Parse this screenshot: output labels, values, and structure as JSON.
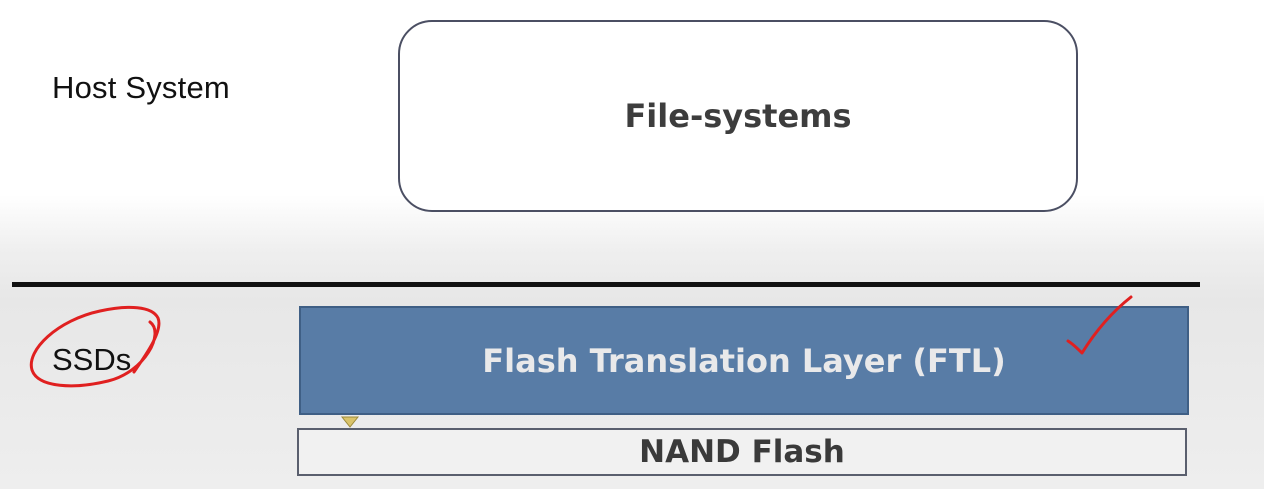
{
  "host": {
    "label": "Host System"
  },
  "filesystems": {
    "label": "File-systems"
  },
  "ssd": {
    "label": "SSDs"
  },
  "ftl": {
    "label": "Flash Translation Layer (FTL)"
  },
  "nand": {
    "label": "NAND Flash"
  },
  "colors": {
    "ftl_fill": "#587ca6",
    "annotation_red": "#e02020",
    "pointer_yellow": "#d9c36a",
    "divider": "#111111"
  },
  "icons": {
    "circle_annotation": "hand-drawn-circle",
    "check_annotation": "check-mark",
    "pointer": "triangle-pointer"
  }
}
